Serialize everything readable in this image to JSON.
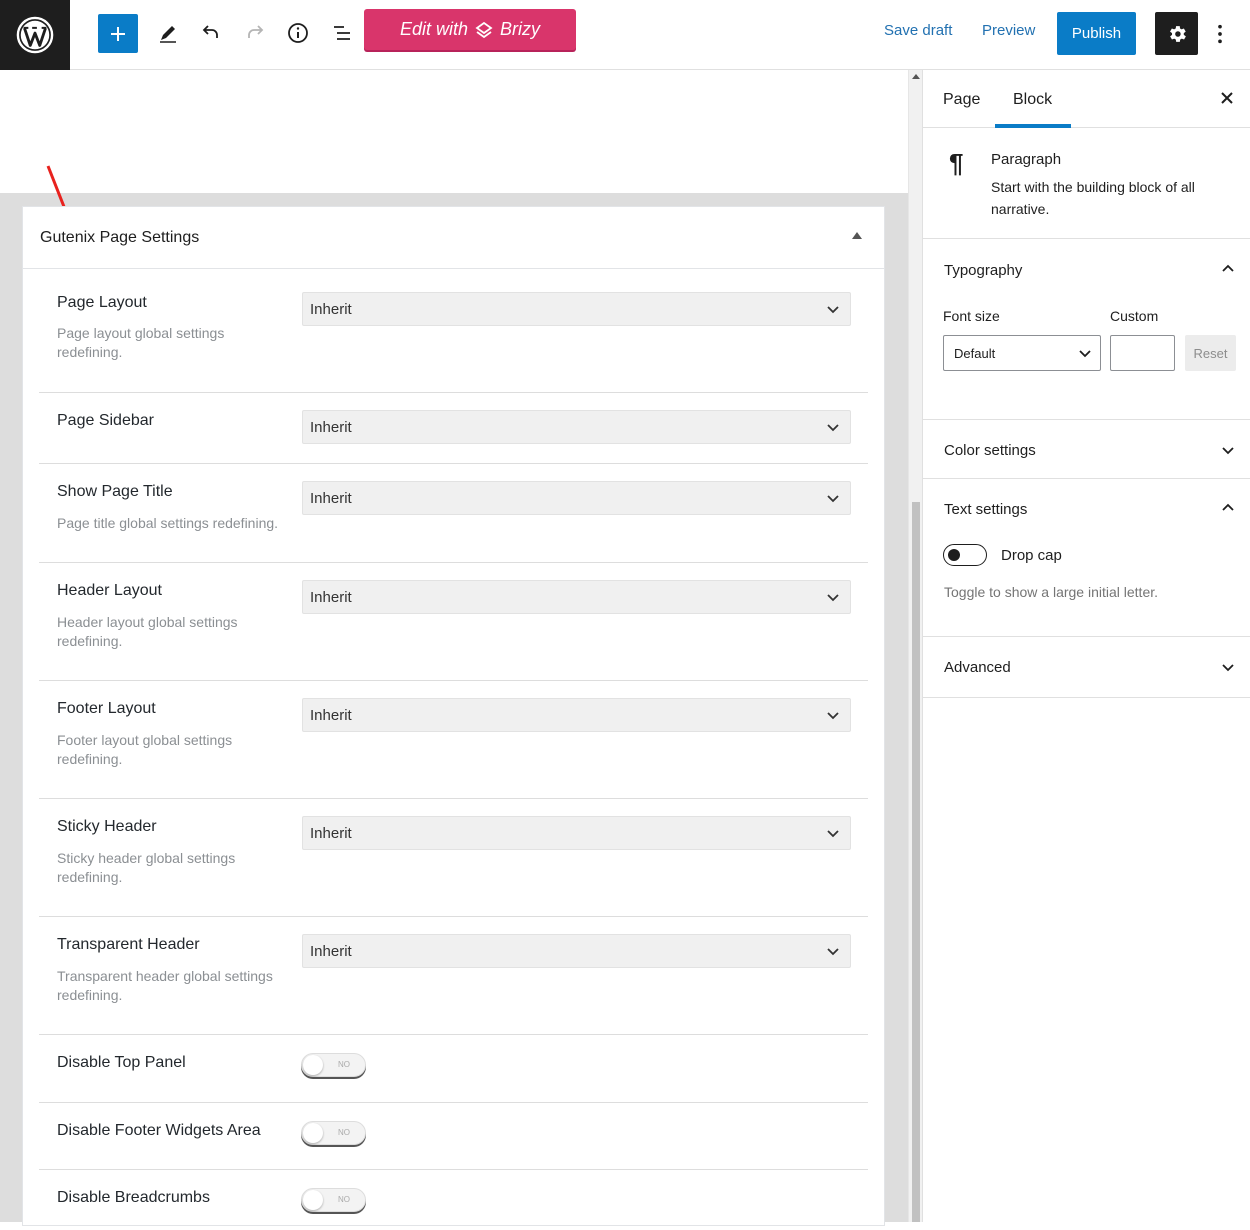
{
  "toolbar": {
    "brizy_label": "Edit with",
    "brizy_brand": "Brizy",
    "save_draft": "Save draft",
    "preview": "Preview",
    "publish": "Publish"
  },
  "panel": {
    "title": "Gutenix Page Settings",
    "select_rows": [
      {
        "title": "Page Layout",
        "desc": "Page layout global settings redefining.",
        "value": "Inherit"
      },
      {
        "title": "Page Sidebar",
        "desc": "",
        "value": "Inherit"
      },
      {
        "title": "Show Page Title",
        "desc": "Page title global settings redefining.",
        "value": "Inherit"
      },
      {
        "title": "Header Layout",
        "desc": "Header layout global settings redefining.",
        "value": "Inherit"
      },
      {
        "title": "Footer Layout",
        "desc": "Footer layout global settings redefining.",
        "value": "Inherit"
      },
      {
        "title": "Sticky Header",
        "desc": "Sticky header global settings redefining.",
        "value": "Inherit"
      },
      {
        "title": "Transparent Header",
        "desc": "Transparent header global settings redefining.",
        "value": "Inherit"
      }
    ],
    "toggle_rows": [
      {
        "title": "Disable Top Panel",
        "state": "NO"
      },
      {
        "title": "Disable Footer Widgets Area",
        "state": "NO"
      },
      {
        "title": "Disable Breadcrumbs",
        "state": "NO"
      }
    ]
  },
  "sidebar": {
    "tabs": [
      "Page",
      "Block"
    ],
    "active_tab": "Block",
    "block": {
      "title": "Paragraph",
      "desc": "Start with the building block of all narrative."
    },
    "typography": {
      "title": "Typography",
      "font_size_label": "Font size",
      "custom_label": "Custom",
      "font_size_value": "Default",
      "custom_value": "",
      "reset_label": "Reset"
    },
    "color_settings": "Color settings",
    "text_settings": {
      "title": "Text settings",
      "drop_cap_label": "Drop cap",
      "drop_cap_help": "Toggle to show a large initial letter."
    },
    "advanced": "Advanced"
  },
  "colors": {
    "accent": "#0a7cc7",
    "brizy": "#d9356b",
    "annotation_arrow": "#e8221e"
  }
}
